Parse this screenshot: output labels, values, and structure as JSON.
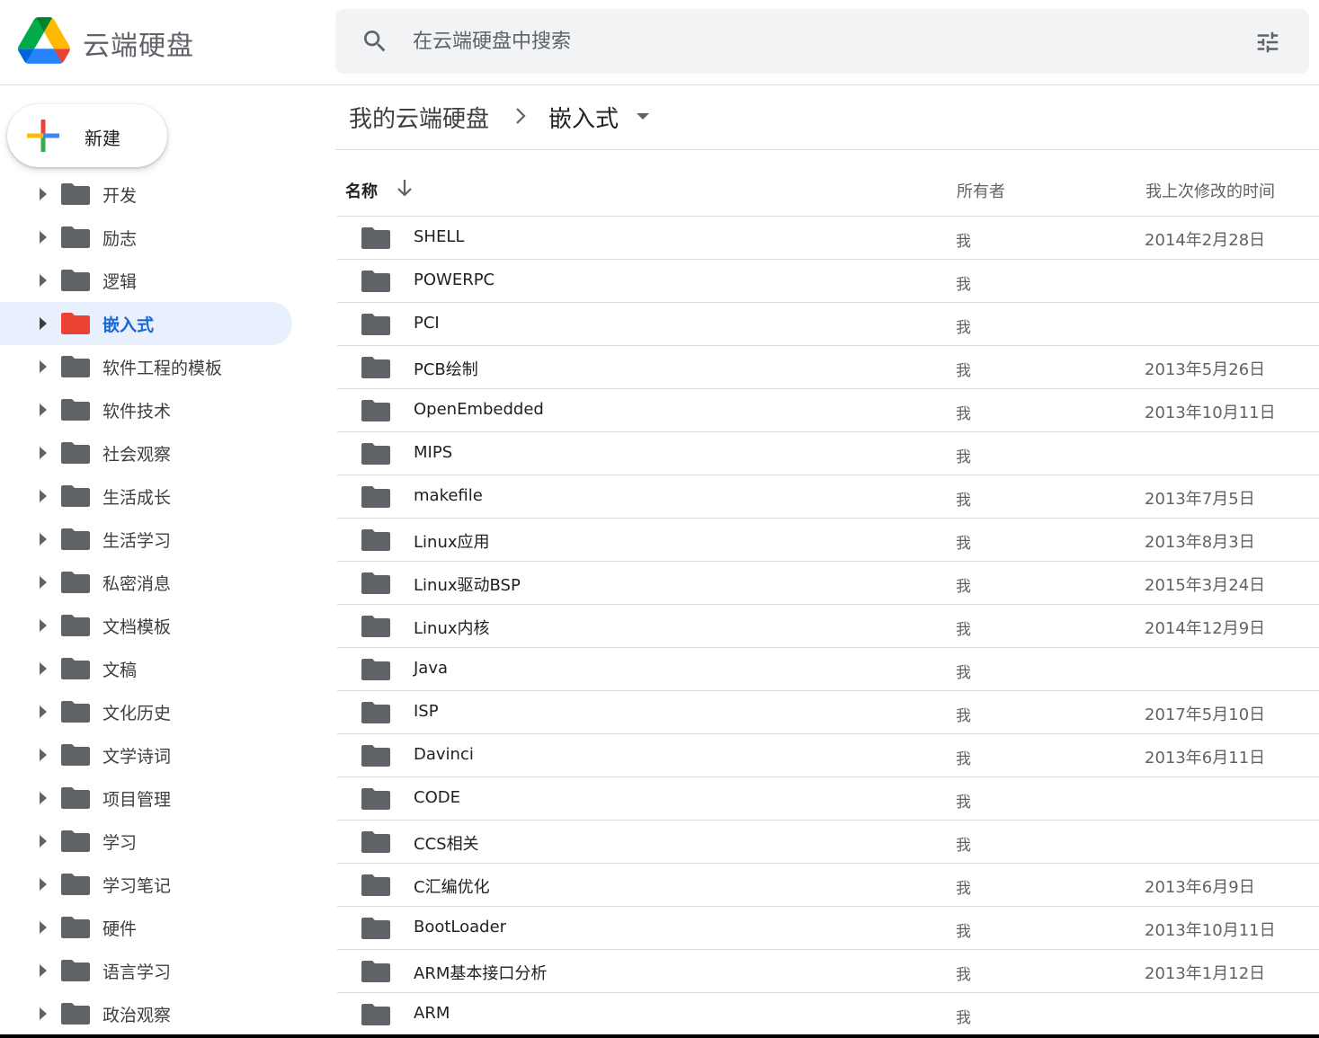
{
  "header": {
    "app_title": "云端硬盘",
    "logo_icon": "google-drive-logo",
    "search": {
      "placeholder": "在云端硬盘中搜索",
      "value": ""
    },
    "search_options_icon": "tune-icon"
  },
  "sidebar": {
    "new_button_label": "新建",
    "tree": [
      {
        "label": "开发",
        "selected": false
      },
      {
        "label": "励志",
        "selected": false
      },
      {
        "label": "逻辑",
        "selected": false
      },
      {
        "label": "嵌入式",
        "selected": true
      },
      {
        "label": "软件工程的模板",
        "selected": false
      },
      {
        "label": "软件技术",
        "selected": false
      },
      {
        "label": "社会观察",
        "selected": false
      },
      {
        "label": "生活成长",
        "selected": false
      },
      {
        "label": "生活学习",
        "selected": false
      },
      {
        "label": "私密消息",
        "selected": false
      },
      {
        "label": "文档模板",
        "selected": false
      },
      {
        "label": "文稿",
        "selected": false
      },
      {
        "label": "文化历史",
        "selected": false
      },
      {
        "label": "文学诗词",
        "selected": false
      },
      {
        "label": "项目管理",
        "selected": false
      },
      {
        "label": "学习",
        "selected": false
      },
      {
        "label": "学习笔记",
        "selected": false
      },
      {
        "label": "硬件",
        "selected": false
      },
      {
        "label": "语言学习",
        "selected": false
      },
      {
        "label": "政治观察",
        "selected": false
      }
    ]
  },
  "breadcrumb": {
    "root": "我的云端硬盘",
    "current": "嵌入式"
  },
  "list": {
    "columns": {
      "name": "名称",
      "owner": "所有者",
      "modified": "我上次修改的时间"
    },
    "rows": [
      {
        "name": "SHELL",
        "owner": "我",
        "modified": "2014年2月28日"
      },
      {
        "name": "POWERPC",
        "owner": "我",
        "modified": ""
      },
      {
        "name": "PCI",
        "owner": "我",
        "modified": ""
      },
      {
        "name": "PCB绘制",
        "owner": "我",
        "modified": "2013年5月26日"
      },
      {
        "name": "OpenEmbedded",
        "owner": "我",
        "modified": "2013年10月11日"
      },
      {
        "name": "MIPS",
        "owner": "我",
        "modified": ""
      },
      {
        "name": "makefile",
        "owner": "我",
        "modified": "2013年7月5日"
      },
      {
        "name": "Linux应用",
        "owner": "我",
        "modified": "2013年8月3日"
      },
      {
        "name": "Linux驱动BSP",
        "owner": "我",
        "modified": "2015年3月24日"
      },
      {
        "name": "Linux内核",
        "owner": "我",
        "modified": "2014年12月9日"
      },
      {
        "name": "Java",
        "owner": "我",
        "modified": ""
      },
      {
        "name": "ISP",
        "owner": "我",
        "modified": "2017年5月10日"
      },
      {
        "name": "Davinci",
        "owner": "我",
        "modified": "2013年6月11日"
      },
      {
        "name": "CODE",
        "owner": "我",
        "modified": ""
      },
      {
        "name": "CCS相关",
        "owner": "我",
        "modified": ""
      },
      {
        "name": "C汇编优化",
        "owner": "我",
        "modified": "2013年6月9日"
      },
      {
        "name": "BootLoader",
        "owner": "我",
        "modified": "2013年10月11日"
      },
      {
        "name": "ARM基本接口分析",
        "owner": "我",
        "modified": "2013年1月12日"
      },
      {
        "name": "ARM",
        "owner": "我",
        "modified": ""
      }
    ]
  },
  "colors": {
    "folder_default": "#5f6368",
    "folder_selected": "#ea4335",
    "selected_bg": "#e8f0fe",
    "selected_text": "#1967d2"
  }
}
